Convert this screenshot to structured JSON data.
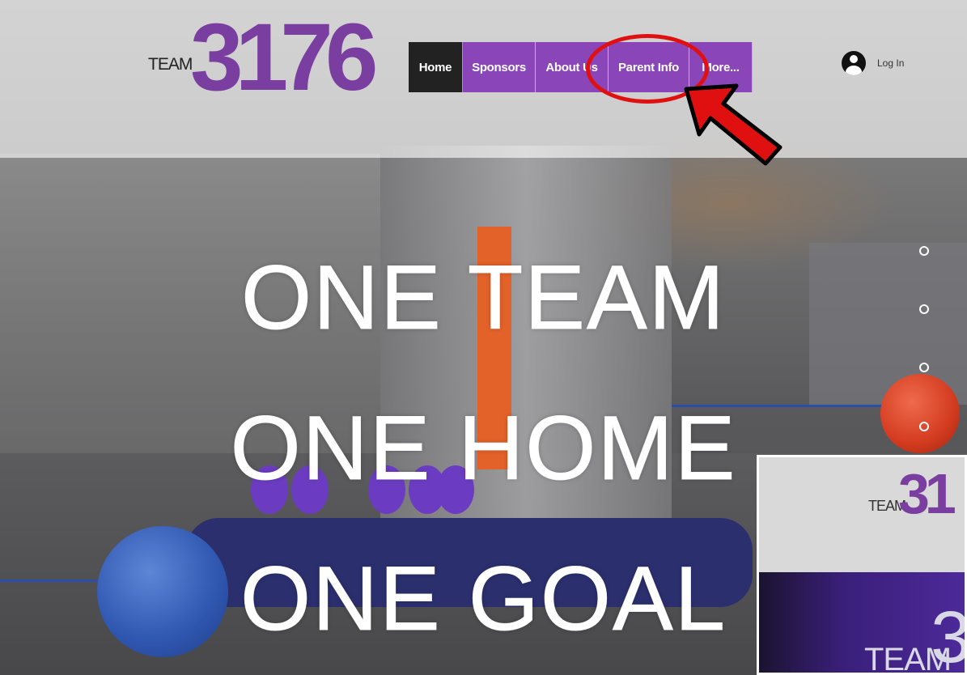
{
  "header": {
    "logo": {
      "word": "TEAM",
      "number": "3176"
    },
    "nav": [
      {
        "label": "Home",
        "active": true
      },
      {
        "label": "Sponsors",
        "active": false
      },
      {
        "label": "About Us",
        "active": false
      },
      {
        "label": "Parent Info",
        "active": false
      },
      {
        "label": "More...",
        "active": false
      }
    ],
    "login_label": "Log In"
  },
  "hero": {
    "lines": [
      "ONE TEAM",
      "ONE HOME",
      "ONE GOAL"
    ]
  },
  "thumbnail": {
    "logo_word": "TEAM",
    "logo_number": "31",
    "shirt_word": "TEAM",
    "shirt_number": "3"
  },
  "colors": {
    "brand_purple": "#8a45b8",
    "nav_active": "#222222",
    "annotation_red": "#e01010"
  }
}
